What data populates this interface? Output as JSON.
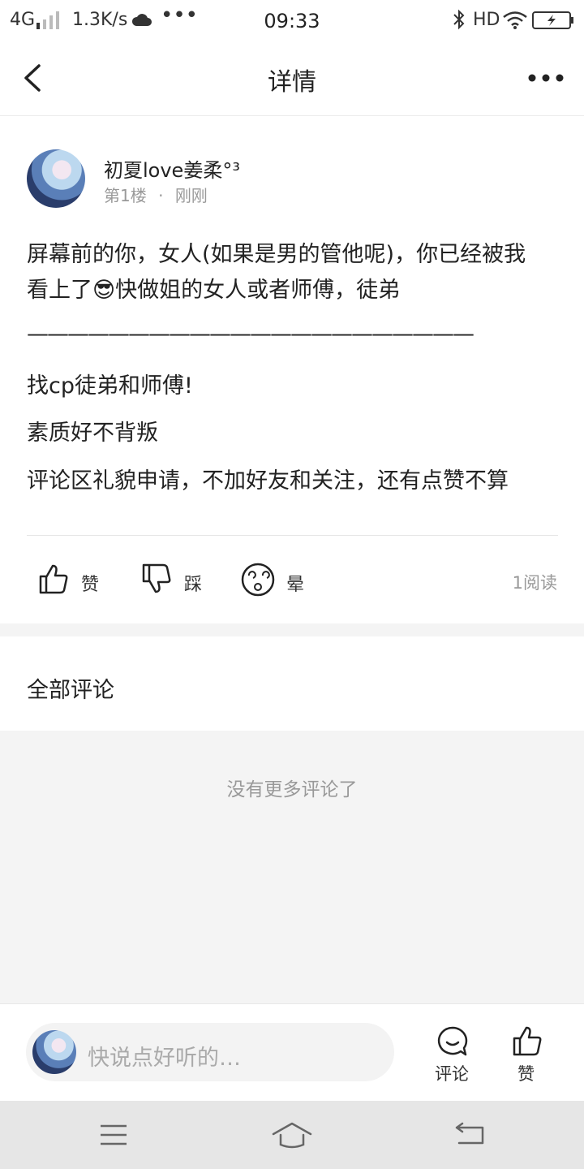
{
  "status_bar": {
    "network": "4G",
    "speed": "1.3K/s",
    "time": "09:33",
    "hd": "HD"
  },
  "header": {
    "title": "详情",
    "back_icon": "chevron-left-icon",
    "more_icon": "more-dots-icon"
  },
  "post": {
    "username": "初夏love姜柔°³",
    "floor": "第1楼",
    "separator": "·",
    "time": "刚刚",
    "paragraphs": [
      "屏幕前的你，女人(如果是男的管他呢)，你已经被我",
      "看上了😎快做姐的女人或者师傅，徒弟",
      "——————————————————————",
      "找cp徒弟和师傅!",
      "素质好不背叛",
      "评论区礼貌申请，不加好友和关注，还有点赞不算"
    ],
    "actions": {
      "like": "赞",
      "dislike": "踩",
      "dizzy": "晕"
    },
    "reads": "1阅读"
  },
  "comments": {
    "section_title": "全部评论",
    "empty_text": "没有更多评论了"
  },
  "bottom_bar": {
    "input_placeholder": "快说点好听的…",
    "comment_label": "评论",
    "like_label": "赞"
  },
  "colors": {
    "text": "#222222",
    "muted": "#999999",
    "band": "#f4f4f4",
    "navbar": "#e6e6e6"
  }
}
